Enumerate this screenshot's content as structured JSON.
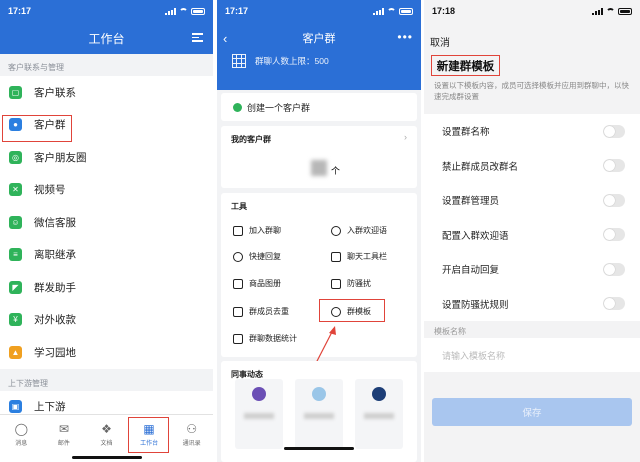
{
  "colors": {
    "brand_blue": "#2b6fd6",
    "highlight_red": "#e0443a",
    "accent_green": "#2fb35a"
  },
  "panel1": {
    "time": "17:17",
    "title": "工作台",
    "section1": "客户联系与管理",
    "items": [
      {
        "label": "客户联系",
        "icon": "contacts-icon"
      },
      {
        "label": "客户群",
        "icon": "person-icon"
      },
      {
        "label": "客户朋友圈",
        "icon": "moments-icon"
      },
      {
        "label": "视频号",
        "icon": "video-icon"
      },
      {
        "label": "微信客服",
        "icon": "service-icon"
      },
      {
        "label": "离职继承",
        "icon": "handover-icon"
      },
      {
        "label": "群发助手",
        "icon": "broadcast-icon"
      },
      {
        "label": "对外收款",
        "icon": "payment-icon"
      },
      {
        "label": "学习园地",
        "icon": "graduation-icon"
      }
    ],
    "section2": "上下游管理",
    "partial_item": "上下游",
    "tabs": [
      {
        "label": "消息",
        "icon": "chat-icon"
      },
      {
        "label": "邮件",
        "icon": "mail-icon"
      },
      {
        "label": "文档",
        "icon": "document-icon"
      },
      {
        "label": "工作台",
        "icon": "grid-icon"
      },
      {
        "label": "通讯录",
        "icon": "people-icon"
      }
    ]
  },
  "panel2": {
    "time": "17:17",
    "title": "客户群",
    "limit_text": "群聊人数上限：500",
    "create_label": "创建一个客户群",
    "my_groups_title": "我的客户群",
    "count_unit": "个",
    "tools_title": "工具",
    "tools": [
      {
        "label": "加入群聊"
      },
      {
        "label": "入群欢迎语"
      },
      {
        "label": "快捷回复"
      },
      {
        "label": "聊天工具栏"
      },
      {
        "label": "商品图册"
      },
      {
        "label": "防骚扰"
      },
      {
        "label": "群成员去重"
      },
      {
        "label": "群模板"
      },
      {
        "label": "群聊数据统计"
      }
    ],
    "feed_title": "同事动态"
  },
  "panel3": {
    "time": "17:18",
    "cancel_label": "取消",
    "title": "新建群模板",
    "description": "设置以下模板内容，成员可选择模板并应用到群聊中，以快速完成群设置",
    "settings": [
      {
        "label": "设置群名称",
        "enabled": false
      },
      {
        "label": "禁止群成员改群名",
        "enabled": false
      },
      {
        "label": "设置群管理员",
        "enabled": false
      },
      {
        "label": "配置入群欢迎语",
        "enabled": false
      },
      {
        "label": "开启自动回复",
        "enabled": false
      },
      {
        "label": "设置防骚扰规则",
        "enabled": false
      }
    ],
    "template_name_label": "模板名称",
    "template_name_placeholder": "请输入模板名称",
    "save_label": "保存"
  }
}
